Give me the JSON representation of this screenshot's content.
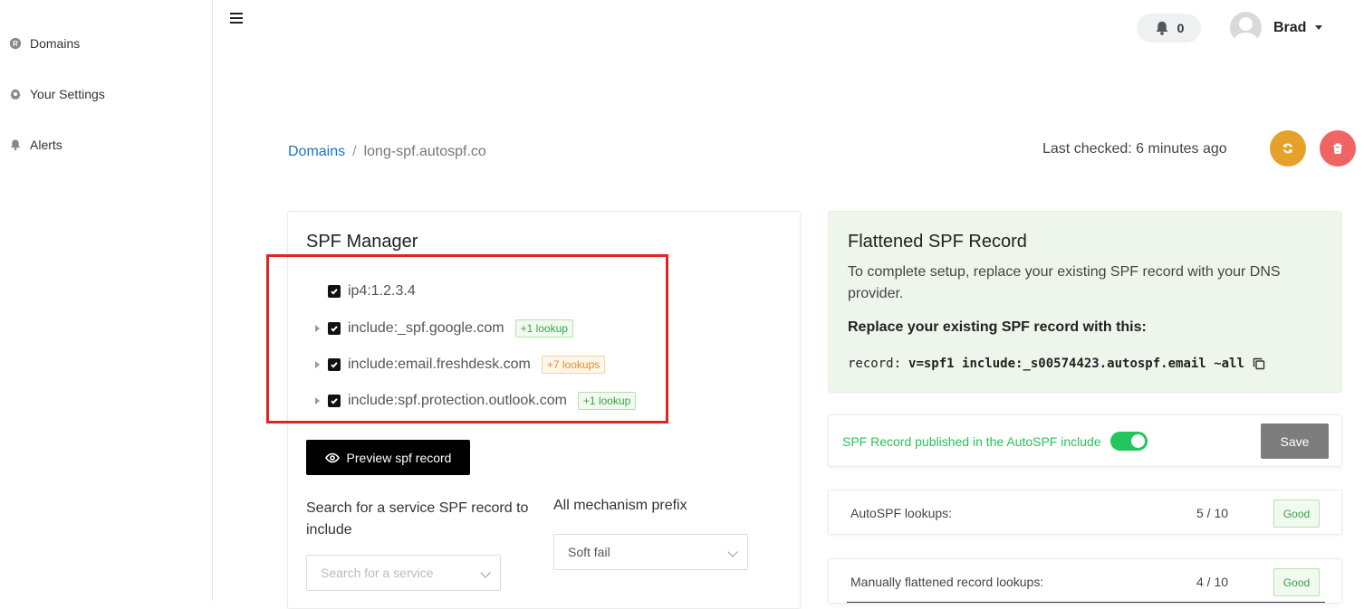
{
  "sidebar": {
    "items": [
      {
        "label": "Domains",
        "icon": "registered-icon"
      },
      {
        "label": "Your Settings",
        "icon": "gear-icon"
      },
      {
        "label": "Alerts",
        "icon": "bell-icon"
      }
    ]
  },
  "header": {
    "notifications_count": "0",
    "user_name": "Brad"
  },
  "breadcrumb": {
    "root": "Domains",
    "separator": "/",
    "current": "long-spf.autospf.co"
  },
  "status": {
    "last_checked": "Last checked: 6 minutes ago"
  },
  "colors": {
    "link": "#1a73c8",
    "refresh": "#e6a12a",
    "delete": "#f06464",
    "toggle_on": "#22c55e",
    "good": "#3aa24a",
    "highlight": "#e02424"
  },
  "spf_manager": {
    "title": "SPF Manager",
    "mechanisms": [
      {
        "value": "ip4:1.2.3.4",
        "checked": true,
        "expandable": false,
        "badge": ""
      },
      {
        "value": "include:_spf.google.com",
        "checked": true,
        "expandable": true,
        "badge": "+1 lookup",
        "badge_color": "green"
      },
      {
        "value": "include:email.freshdesk.com",
        "checked": true,
        "expandable": true,
        "badge": "+7 lookups",
        "badge_color": "orange"
      },
      {
        "value": "include:spf.protection.outlook.com",
        "checked": true,
        "expandable": true,
        "badge": "+1 lookup",
        "badge_color": "green"
      }
    ],
    "preview_button": "Preview spf record",
    "search_label": "Search for a service SPF record to include",
    "search_placeholder": "Search for a service",
    "prefix_label": "All mechanism prefix",
    "prefix_value": "Soft fail"
  },
  "flattened": {
    "title": "Flattened SPF Record",
    "description": "To complete setup, replace your existing SPF record with your DNS provider.",
    "replace_label": "Replace your existing SPF record with this:",
    "record_key": "record:",
    "record_value": "v=spf1 include:_s00574423.autospf.email ~all"
  },
  "publish": {
    "text": "SPF Record published in the AutoSPF include",
    "toggle_on": true,
    "save_label": "Save"
  },
  "lookups": [
    {
      "label": "AutoSPF lookups:",
      "value": "5 / 10",
      "status": "Good"
    },
    {
      "label": "Manually flattened record lookups:",
      "value": "4 / 10",
      "status": "Good"
    }
  ]
}
